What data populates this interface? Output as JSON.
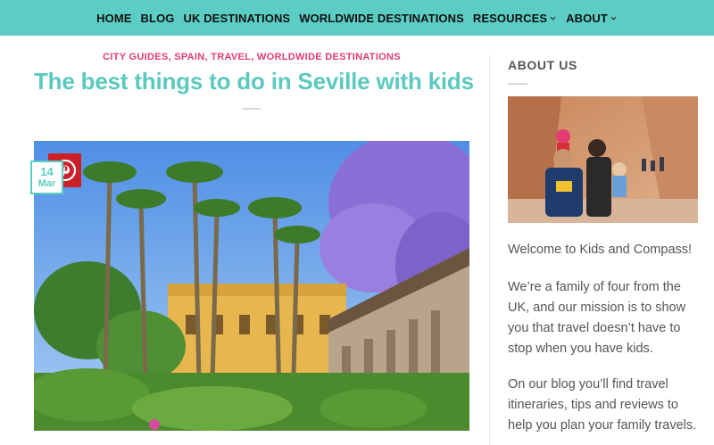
{
  "nav": {
    "items": [
      {
        "label": "HOME",
        "dropdown": false
      },
      {
        "label": "BLOG",
        "dropdown": false
      },
      {
        "label": "UK DESTINATIONS",
        "dropdown": false
      },
      {
        "label": "WORLDWIDE DESTINATIONS",
        "dropdown": false
      },
      {
        "label": "RESOURCES",
        "dropdown": true
      },
      {
        "label": "ABOUT",
        "dropdown": true
      }
    ]
  },
  "article": {
    "categories": [
      "CITY GUIDES",
      "SPAIN",
      "TRAVEL",
      "WORLDWIDE DESTINATIONS"
    ],
    "title": "The best things to do in Seville with kids",
    "date": {
      "day": "14",
      "month": "Mar"
    },
    "share_icon": "pinterest-icon"
  },
  "sidebar": {
    "heading": "ABOUT US",
    "paragraphs": [
      "Welcome to Kids and Compass!",
      "We’re a family of four from the UK, and our mission is to show you that travel doesn’t have to stop when you have kids.",
      "On our blog you’ll find travel itineraries, tips and reviews to help you plan your family travels."
    ]
  },
  "colors": {
    "nav_bg": "#5ccdc4",
    "title": "#5cc9c0",
    "category": "#e33b6f",
    "pinterest": "#cb2027"
  }
}
